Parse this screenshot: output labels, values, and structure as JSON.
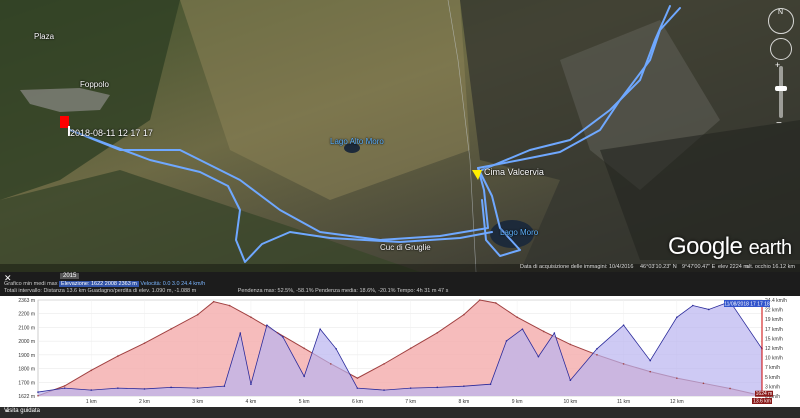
{
  "map": {
    "places": {
      "plaza": "Plaza",
      "foppolo": "Foppolo",
      "cima_valcervia": "Cima Valcervia",
      "lago_moro": "Lago Moro",
      "lago_alto": "Lago Alto Moro",
      "coda_di_cavallo": "Cuc di Gruglie"
    },
    "track_timestamp": "2018-08-11 12 17 17",
    "logo": {
      "google": "Google",
      "earth": "earth"
    },
    "status": {
      "year": "2015",
      "imagery_date": "Data di acquisizione delle immagini: 10/4/2016",
      "lat": "46°03'10.23\" N",
      "lon": "9°47'00.47\" E",
      "elev": "elev  2224 m",
      "eye_alt": "alt. occhio  16.12 km"
    },
    "compass_n": "N",
    "colors": {
      "track": "#6fa8ff",
      "marker_start": "#ff0000",
      "marker_summit": "#ffee00"
    }
  },
  "profile": {
    "year_badge": "2015",
    "row1": {
      "label": "Grafico  min  medi  max",
      "elev_label": "Elevazione: 1622  2008  2363 m",
      "speed_label": "Velocità: 0.0  3.0  24.4 km/h"
    },
    "row2": {
      "label": "Totali intervallo:",
      "distance": "Distanza  13.6 km",
      "gain": "Guadagno/perdita di elev.  1.090 m, -1.088 m",
      "slope_max": "Pendenza max: 52.5%, -58.1%",
      "slope_avg": "Pendenza media: 18.6%, -20.1%",
      "time": "Tempo: 4h 31 m 47 s"
    },
    "left_ticks": [
      "2363 m",
      "2200 m",
      "2100 m",
      "2000 m",
      "1900 m",
      "1800 m",
      "1700 m",
      "1622 m"
    ],
    "right_ticks": [
      "24.4 km/h",
      "22 km/h",
      "19 km/h",
      "17 km/h",
      "15 km/h",
      "12 km/h",
      "10 km/h",
      "7 km/h",
      "5 km/h",
      "3 km/h",
      "0 km/h"
    ],
    "x_ticks": [
      "1 km",
      "2 km",
      "3 km",
      "4 km",
      "5 km",
      "6 km",
      "7 km",
      "8 km",
      "9 km",
      "10 km",
      "11 km",
      "12 km"
    ],
    "end_marker_time": "11/08/2018 17 17 18",
    "end_elev": "1624 m",
    "end_dist": "13.6 km",
    "colors": {
      "elev_fill": "#f4b0b0",
      "elev_line": "#a04040",
      "speed_fill": "#b9b3f0",
      "speed_line": "#2a2a9a"
    }
  },
  "bottom": {
    "panel_label": "Visita guidata"
  },
  "chart_data": {
    "type": "area",
    "x_unit": "km",
    "xlim": [
      0,
      13.6
    ],
    "ylim": [
      1622,
      2363
    ],
    "series": [
      {
        "name": "Elevazione",
        "x": [
          0,
          0.5,
          1,
          1.5,
          2,
          2.5,
          3,
          3.3,
          3.6,
          4,
          4.5,
          5,
          5.5,
          6,
          6.5,
          7,
          7.5,
          8,
          8.3,
          8.6,
          9,
          9.5,
          10,
          10.5,
          11,
          11.5,
          12,
          12.5,
          13,
          13.6
        ],
        "y": [
          1624,
          1700,
          1820,
          1930,
          2030,
          2140,
          2250,
          2350,
          2320,
          2230,
          2110,
          1990,
          1870,
          1760,
          1870,
          1990,
          2110,
          2250,
          2363,
          2340,
          2230,
          2120,
          2020,
          1940,
          1870,
          1810,
          1760,
          1720,
          1680,
          1624
        ]
      },
      {
        "name": "Velocità",
        "x": [
          0,
          0.5,
          1,
          1.5,
          2,
          2.5,
          3,
          3.5,
          3.8,
          4,
          4.3,
          4.6,
          5,
          5.3,
          5.6,
          6,
          6.5,
          7,
          7.5,
          8,
          8.5,
          8.8,
          9.1,
          9.4,
          9.7,
          10,
          10.5,
          11,
          11.5,
          12,
          12.3,
          12.6,
          13,
          13.6
        ],
        "y": [
          1,
          2,
          1.5,
          2,
          1.8,
          2.2,
          2,
          2.5,
          16,
          3,
          18,
          15,
          5,
          17,
          12,
          2,
          1.5,
          2,
          2.2,
          2.5,
          3,
          14,
          17,
          10,
          16,
          4,
          12,
          18,
          9,
          20,
          23,
          22,
          24,
          12
        ]
      }
    ]
  }
}
